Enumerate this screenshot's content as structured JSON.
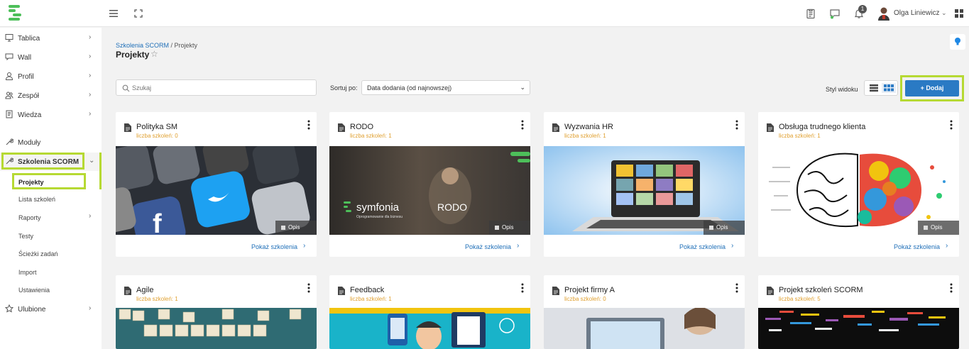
{
  "header": {
    "user_name": "Olga Liniewicz",
    "notification_count": "1",
    "colors": {
      "accent": "#2a7ac4",
      "highlight": "#b6d933",
      "logo": "#4dbf5a"
    }
  },
  "sidebar": {
    "items": [
      {
        "label": "Tablica",
        "icon": "monitor-icon"
      },
      {
        "label": "Wall",
        "icon": "chat-icon"
      },
      {
        "label": "Profil",
        "icon": "user-icon"
      },
      {
        "label": "Zespół",
        "icon": "team-icon"
      },
      {
        "label": "Wiedza",
        "icon": "book-icon"
      },
      {
        "label": "Moduły",
        "icon": "wrench-icon"
      },
      {
        "label": "Szkolenia SCORM",
        "icon": "wrench-icon"
      },
      {
        "label": "Ulubione",
        "icon": "star-icon"
      }
    ],
    "subitems": [
      "Projekty",
      "Lista szkoleń",
      "Raporty",
      "Testy",
      "Ścieżki zadań",
      "Import",
      "Ustawienia"
    ]
  },
  "breadcrumb": {
    "link": "Szkolenia SCORM",
    "separator": " / ",
    "current": "Projekty"
  },
  "page_title": "Projekty",
  "toolbar": {
    "search_placeholder": "Szukaj",
    "sort_label": "Sortuj po:",
    "sort_value": "Data dodania (od najnowszej)",
    "style_label": "Styl widoku",
    "add_label": "+ Dodaj"
  },
  "cards": [
    {
      "title": "Polityka SM",
      "count": "liczba szkoleń: 0",
      "opis": "Opis",
      "show": "Pokaż szkolenia",
      "image": "social-media-apps"
    },
    {
      "title": "RODO",
      "count": "liczba szkoleń: 1",
      "opis": "Opis",
      "show": "Pokaż szkolenia",
      "image": "symfonia-rodo",
      "brand": "symfonia",
      "brand_sub": "Oprogramowanie dla biznesu",
      "overlay": "RODO"
    },
    {
      "title": "Wyzwania HR",
      "count": "liczba szkoleń: 1",
      "opis": "Opis",
      "show": "Pokaż szkolenia",
      "image": "video-call-laptop"
    },
    {
      "title": "Obsługa trudnego klienta",
      "count": "liczba szkoleń: 1",
      "opis": "Opis",
      "show": "Pokaż szkolenia",
      "image": "brain-colorful"
    },
    {
      "title": "Agile",
      "count": "liczba szkoleń: 1",
      "image": "scrabble-learning"
    },
    {
      "title": "Feedback",
      "count": "liczba szkoleń: 1",
      "image": "feedback-illustration"
    },
    {
      "title": "Projekt firmy A",
      "count": "liczba szkoleń: 0",
      "image": "laptop-photo"
    },
    {
      "title": "Projekt szkoleń SCORM",
      "count": "liczba szkoleń: 5",
      "image": "word-cloud"
    }
  ]
}
